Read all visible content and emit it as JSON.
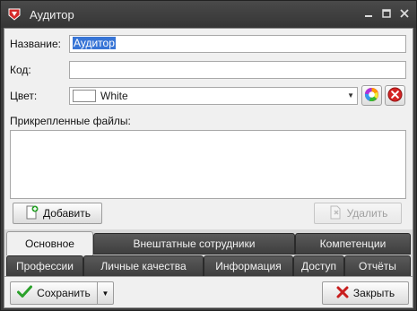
{
  "window": {
    "title": "Аудитор"
  },
  "form": {
    "name_label": "Название:",
    "name_value": "Аудитор",
    "code_label": "Код:",
    "code_value": "",
    "color_label": "Цвет:",
    "color_value": "White",
    "color_swatch": "#ffffff",
    "files_label": "Прикрепленные файлы:"
  },
  "file_buttons": {
    "add": "Добавить",
    "delete": "Удалить"
  },
  "tabs": {
    "row1": [
      "Основное",
      "Внештатные сотрудники",
      "Компетенции"
    ],
    "row2": [
      "Профессии",
      "Личные качества",
      "Информация",
      "Доступ",
      "Отчёты"
    ],
    "active": "Основное"
  },
  "footer": {
    "save": "Сохранить",
    "close": "Закрыть"
  },
  "icons": {
    "app": "app-logo-icon",
    "minimize": "minimize-icon",
    "maximize": "maximize-icon",
    "close": "close-icon",
    "palette": "color-palette-icon",
    "clear": "clear-color-icon",
    "add_file": "add-file-icon",
    "delete_file": "delete-file-icon",
    "save": "checkmark-icon",
    "close_form": "red-x-icon"
  },
  "colors": {
    "accent_selection": "#3875d6",
    "save_check": "#2aa12a",
    "close_x": "#c81e1e"
  }
}
